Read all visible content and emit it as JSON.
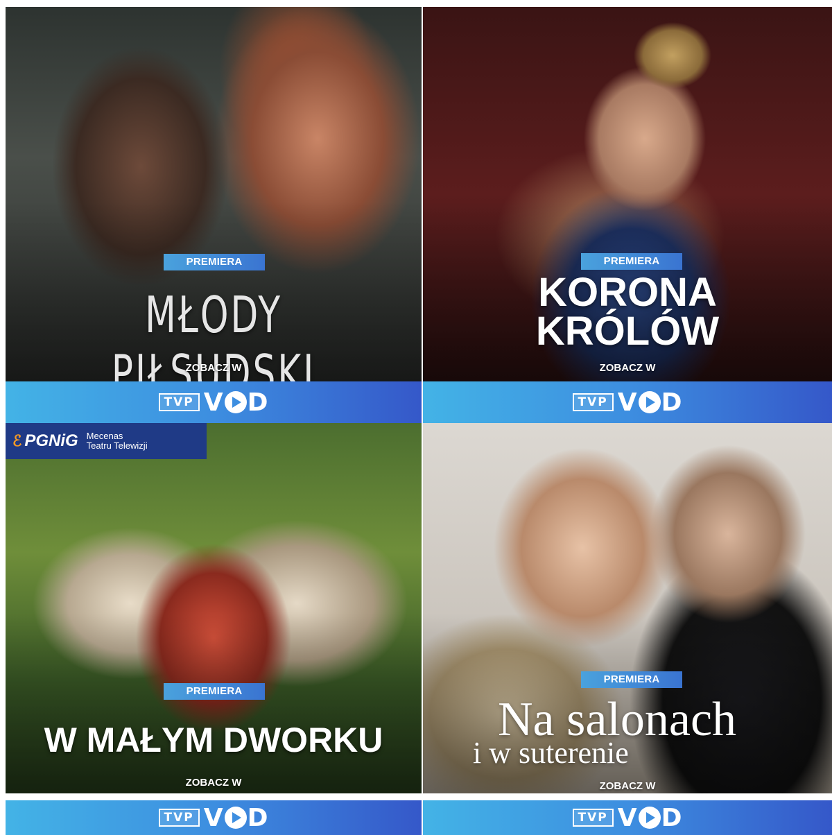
{
  "tiles": [
    {
      "badge": "PREMIERA",
      "title": "MŁODY PIŁSUDSKI",
      "zobacz": "ZOBACZ W",
      "brand": {
        "tvp": "TVP",
        "vod": "VOD"
      }
    },
    {
      "badge": "PREMIERA",
      "title_line1": "KORONA",
      "title_line2": "KRÓLÓW",
      "zobacz": "ZOBACZ W",
      "brand": {
        "tvp": "TVP",
        "vod": "VOD"
      }
    },
    {
      "sponsor": {
        "logo": "PGNiG",
        "line1": "Mecenas",
        "line2": "Teatru Telewizji"
      },
      "badge": "PREMIERA",
      "title": "W MAŁYM DWORKU",
      "zobacz": "ZOBACZ W",
      "brand": {
        "tvp": "TVP",
        "vod": "VOD"
      }
    },
    {
      "badge": "PREMIERA",
      "title_line1": "Na salonach",
      "title_line2": "i w suterenie",
      "zobacz": "ZOBACZ W",
      "brand": {
        "tvp": "TVP",
        "vod": "VOD"
      }
    }
  ],
  "colors": {
    "badge": "#3a74d1",
    "bar_start": "#43b3e6",
    "bar_end": "#3558c9",
    "sponsor_bg": "#1f3a86"
  }
}
